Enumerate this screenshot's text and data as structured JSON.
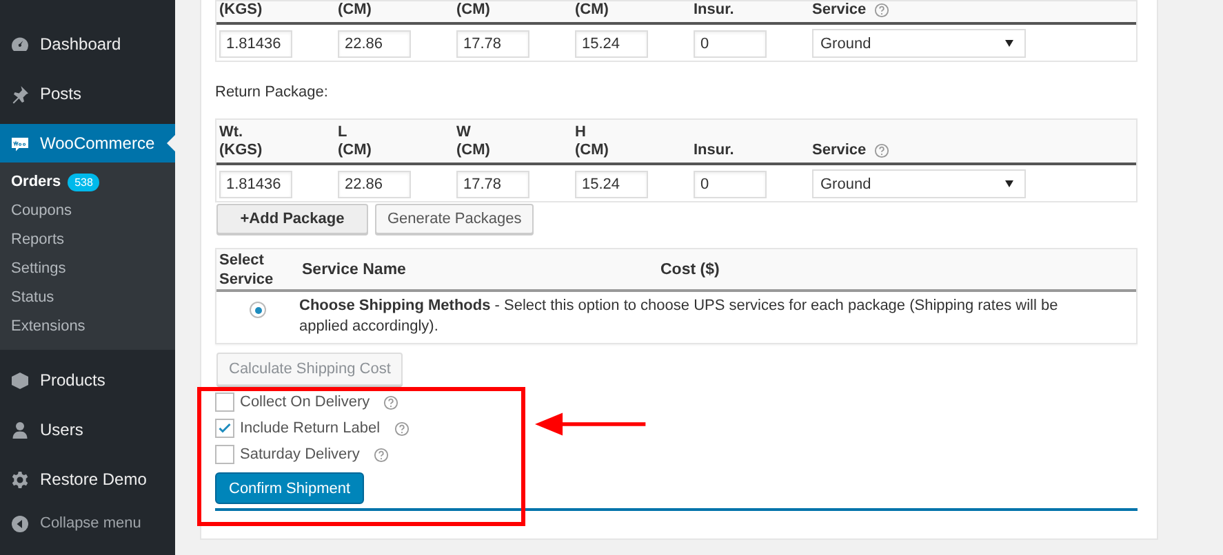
{
  "sidebar": {
    "items": [
      {
        "label": "Dashboard",
        "selected": false
      },
      {
        "label": "Posts",
        "selected": false
      },
      {
        "label": "WooCommerce",
        "selected": true
      },
      {
        "label": "Products",
        "selected": false
      },
      {
        "label": "Users",
        "selected": false
      },
      {
        "label": "Restore Demo",
        "selected": false
      }
    ],
    "submenu": [
      {
        "label": "Orders",
        "selected": true,
        "badge": "538"
      },
      {
        "label": "Coupons",
        "selected": false
      },
      {
        "label": "Reports",
        "selected": false
      },
      {
        "label": "Settings",
        "selected": false
      },
      {
        "label": "Status",
        "selected": false
      },
      {
        "label": "Extensions",
        "selected": false
      }
    ],
    "collapse": "Collapse menu"
  },
  "packages": [
    {
      "columns": [
        [
          "(KGS)"
        ],
        [
          "(CM)"
        ],
        [
          "(CM)"
        ],
        [
          "(CM)"
        ],
        [
          "Insur."
        ],
        [
          "Service"
        ]
      ],
      "values": [
        "1.81436",
        "22.86",
        "17.78",
        "15.24",
        "0"
      ],
      "service": "Ground"
    },
    {
      "heading": "Return Package:",
      "columns": [
        [
          "Wt.",
          "(KGS)"
        ],
        [
          "L",
          "(CM)"
        ],
        [
          "W",
          "(CM)"
        ],
        [
          "H",
          "(CM)"
        ],
        [
          "Insur."
        ],
        [
          "Service"
        ]
      ],
      "values": [
        "1.81436",
        "22.86",
        "17.78",
        "15.24",
        "0"
      ],
      "service": "Ground"
    }
  ],
  "package_buttons": [
    "+Add Package",
    "Generate Packages"
  ],
  "service_table": {
    "columns": [
      "Select Service",
      "Service Name",
      "Cost ($)"
    ],
    "rows": [
      {
        "selected": true,
        "description": "**Choose Shipping Methods** - Select this option to choose UPS services for each package (Shipping rates will be applied accordingly)."
      }
    ]
  },
  "calculate_button": {
    "label": "Calculate Shipping Cost",
    "disabled": true
  },
  "options": [
    {
      "label": "Collect On Delivery",
      "checked": false
    },
    {
      "label": "Include Return Label",
      "checked": true
    },
    {
      "label": "Saturday Delivery",
      "checked": false
    }
  ],
  "confirm_button": "Confirm Shipment"
}
